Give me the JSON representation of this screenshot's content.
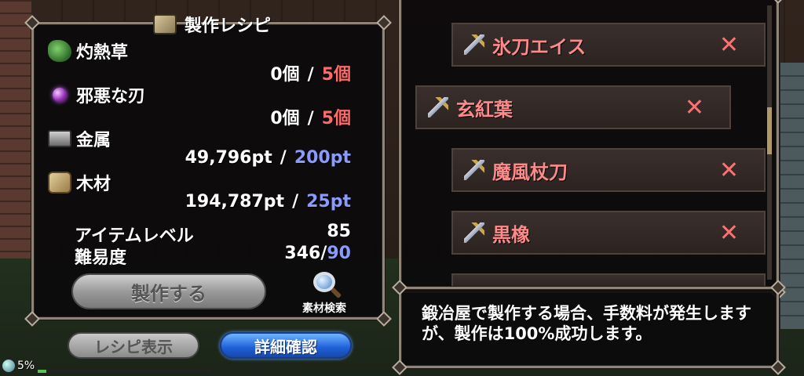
{
  "recipe": {
    "title": "製作レシピ",
    "materials": [
      {
        "name": "灼熱草",
        "icon": "herb-icon",
        "have": "0個",
        "need": "5個",
        "need_color": "red"
      },
      {
        "name": "邪悪な刃",
        "icon": "orb-icon",
        "have": "0個",
        "need": "5個",
        "need_color": "red"
      },
      {
        "name": "金属",
        "icon": "metal-icon",
        "have": "49,796pt",
        "need": "200pt",
        "need_color": "blue"
      },
      {
        "name": "木材",
        "icon": "wood-icon",
        "have": "194,787pt",
        "need": "25pt",
        "need_color": "blue"
      }
    ],
    "separator": "/",
    "item_level_label": "アイテムレベル",
    "item_level_value": "85",
    "difficulty_label": "難易度",
    "difficulty_value": "346",
    "difficulty_separator": "/",
    "difficulty_max": "90",
    "craft_button": "製作する",
    "material_search": "素材検索"
  },
  "buttons": {
    "recipe_display": "レシピ表示",
    "detail_confirm": "詳細確認"
  },
  "status": {
    "text": "5%",
    "progress": 0.05
  },
  "list": {
    "items": [
      {
        "name": "氷刀エイス",
        "icon": "sword-icon",
        "remove": "✕"
      },
      {
        "name": "玄紅葉",
        "icon": "sword-icon",
        "remove": "✕"
      },
      {
        "name": "魔風杖刀",
        "icon": "sword-icon",
        "remove": "✕"
      },
      {
        "name": "黒橡",
        "icon": "sword-icon",
        "remove": "✕"
      }
    ]
  },
  "message": {
    "text": "鍛冶屋で製作する場合、手数料が発生しますが、製作は100%成功します。"
  },
  "colors": {
    "required_red": "#ff6a6a",
    "required_blue": "#8a9bff",
    "item_name": "#ff8a8a",
    "confirm_blue": "#1f5fd8"
  }
}
